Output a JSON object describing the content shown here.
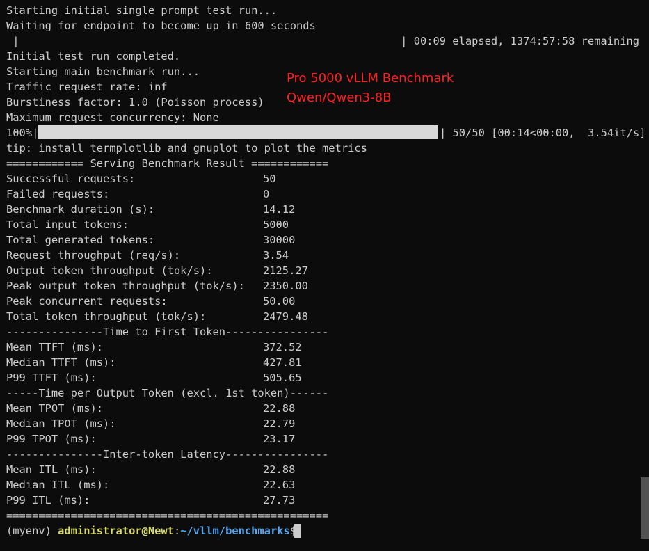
{
  "terminal": {
    "lines": {
      "start_test": "Starting initial single prompt test run...",
      "waiting": "Waiting for endpoint to become up in 600 seconds",
      "wait_bar_left": " |",
      "wait_bar_right": "| 00:09 elapsed, 1374:57:58 remaining",
      "test_completed": "Initial test run completed.",
      "starting_main": "Starting main benchmark run...",
      "traffic_rate": "Traffic request rate: inf",
      "burstiness": "Burstiness factor: 1.0 (Poisson process)",
      "max_concurrency": "Maximum request concurrency: None",
      "progress_percent": "100%|",
      "progress_status": "| 50/50 [00:14<00:00,  3.54it/s]",
      "tip": "tip: install termplotlib and gnuplot to plot the metrics",
      "result_header": "============ Serving Benchmark Result ============",
      "ttft_header": "---------------Time to First Token----------------",
      "tpot_header": "-----Time per Output Token (excl. 1st token)------",
      "itl_header": "---------------Inter-token Latency----------------",
      "footer": "=================================================="
    },
    "progress": {
      "fraction": 1.0
    },
    "overlay": {
      "title": "Pro 5000 vLLM Benchmark",
      "model": "Qwen/Qwen3-8B"
    },
    "results": [
      {
        "label": "Successful requests:",
        "value": "50"
      },
      {
        "label": "Failed requests:",
        "value": "0"
      },
      {
        "label": "Benchmark duration (s):",
        "value": "14.12"
      },
      {
        "label": "Total input tokens:",
        "value": "5000"
      },
      {
        "label": "Total generated tokens:",
        "value": "30000"
      },
      {
        "label": "Request throughput (req/s):",
        "value": "3.54"
      },
      {
        "label": "Output token throughput (tok/s):",
        "value": "2125.27"
      },
      {
        "label": "Peak output token throughput (tok/s):",
        "value": "2350.00"
      },
      {
        "label": "Peak concurrent requests:",
        "value": "50.00"
      },
      {
        "label": "Total token throughput (tok/s):",
        "value": "2479.48"
      }
    ],
    "ttft": [
      {
        "label": "Mean TTFT (ms):",
        "value": "372.52"
      },
      {
        "label": "Median TTFT (ms):",
        "value": "427.81"
      },
      {
        "label": "P99 TTFT (ms):",
        "value": "505.65"
      }
    ],
    "tpot": [
      {
        "label": "Mean TPOT (ms):",
        "value": "22.88"
      },
      {
        "label": "Median TPOT (ms):",
        "value": "22.79"
      },
      {
        "label": "P99 TPOT (ms):",
        "value": "23.17"
      }
    ],
    "itl": [
      {
        "label": "Mean ITL (ms):",
        "value": "22.88"
      },
      {
        "label": "Median ITL (ms):",
        "value": "22.63"
      },
      {
        "label": "P99 ITL (ms):",
        "value": "27.73"
      }
    ],
    "prompt": {
      "env": "(myenv) ",
      "user_host": "administrator@Newt",
      "separator": ":",
      "path": "~/vllm/benchmarks",
      "symbol": "$ "
    }
  },
  "colors": {
    "background": "#0c0c0c",
    "foreground": "#cccccc",
    "overlay_text": "#ff2020",
    "prompt_user": "#d7d96f",
    "prompt_path": "#5aa7ea",
    "progress_bar": "#d8d8d8"
  }
}
